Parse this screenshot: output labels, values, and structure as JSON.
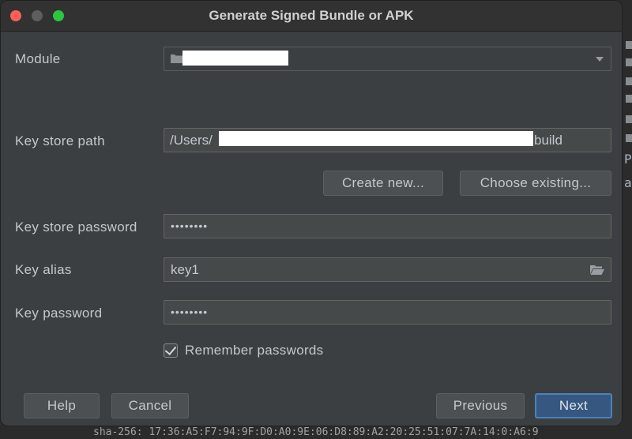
{
  "background": {
    "right_chars": [
      "P",
      "a"
    ],
    "bottom_text": "sha-256: 17:36:A5:F7:94:9F:D0:A0:9E:06:D8:89:A2:20:25:51:07:7A:14:0:A6:9"
  },
  "dialog": {
    "title": "Generate Signed Bundle or APK"
  },
  "form": {
    "module_label": "Module",
    "module_value": "",
    "keystore_path_label": "Key store path",
    "keystore_path_prefix": "/Users/",
    "keystore_path_suffix": "build",
    "create_new_label": "Create new...",
    "choose_existing_label": "Choose existing...",
    "keystore_password_label": "Key store password",
    "keystore_password_value": "••••••••",
    "key_alias_label": "Key alias",
    "key_alias_value": "key1",
    "key_password_label": "Key password",
    "key_password_value": "••••••••",
    "remember_label": "Remember passwords",
    "remember_checked": true
  },
  "footer": {
    "help_label": "Help",
    "cancel_label": "Cancel",
    "previous_label": "Previous",
    "next_label": "Next"
  },
  "colors": {
    "dialog_bg": "#3c3f41",
    "primary_button": "#365880",
    "primary_border": "#4b81bd"
  },
  "icons": {
    "close": "close-icon",
    "minimize": "minimize-icon",
    "maximize": "maximize-icon",
    "module": "folder-icon",
    "dropdown": "chevron-down-icon",
    "browse": "folder-open-icon",
    "check": "checkmark-icon"
  }
}
